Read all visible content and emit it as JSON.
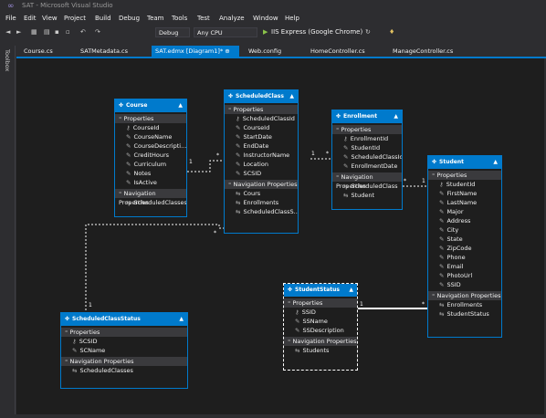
{
  "window": {
    "title": "SAT - Microsoft Visual Studio"
  },
  "menu": [
    "File",
    "Edit",
    "View",
    "Project",
    "Build",
    "Debug",
    "Team",
    "Tools",
    "Test",
    "Analyze",
    "Window",
    "Help"
  ],
  "toolbar": {
    "configuration": "Debug",
    "platform": "Any CPU",
    "run_label": "IIS Express (Google Chrome)"
  },
  "sidebar": {
    "toolbox_label": "Toolbox"
  },
  "tabs": [
    {
      "label": "Course.cs",
      "active": false
    },
    {
      "label": "SATMetadata.cs",
      "active": false
    },
    {
      "label": "SAT.edmx [Diagram1]*",
      "active": true
    },
    {
      "label": "Web.config",
      "active": false
    },
    {
      "label": "HomeController.cs",
      "active": false
    },
    {
      "label": "ManageController.cs",
      "active": false
    }
  ],
  "diagram": {
    "properties_label": "Properties",
    "nav_label": "Navigation Properties",
    "entities": {
      "course": {
        "name": "Course",
        "properties": [
          "CourseId",
          "CourseName",
          "CourseDescripti...",
          "CreditHours",
          "Curriculum",
          "Notes",
          "IsActive"
        ],
        "navigation": [
          "ScheduledClasses"
        ]
      },
      "scheduledclass": {
        "name": "ScheduledClass",
        "properties": [
          "ScheduledClassId",
          "CourseId",
          "StartDate",
          "EndDate",
          "InstructorName",
          "Location",
          "SCSID"
        ],
        "navigation": [
          "Cours",
          "Enrollments",
          "ScheduledClassS..."
        ]
      },
      "enrollment": {
        "name": "Enrollment",
        "properties": [
          "EnrollmentId",
          "StudentId",
          "ScheduledClassId",
          "EnrollmentDate"
        ],
        "navigation": [
          "ScheduledClass",
          "Student"
        ]
      },
      "student": {
        "name": "Student",
        "properties": [
          "StudentId",
          "FirstName",
          "LastName",
          "Major",
          "Address",
          "City",
          "State",
          "ZipCode",
          "Phone",
          "Email",
          "PhotoUrl",
          "SSID"
        ],
        "navigation": [
          "Enrollments",
          "StudentStatus"
        ]
      },
      "scheduledclassstatus": {
        "name": "ScheduledClassStatus",
        "properties": [
          "SCSID",
          "SCName"
        ],
        "navigation": [
          "ScheduledClasses"
        ]
      },
      "studentstatus": {
        "name": "StudentStatus",
        "properties": [
          "SSID",
          "SSName",
          "SSDescription"
        ],
        "navigation": [
          "Students"
        ]
      }
    },
    "multiplicity": {
      "one": "1",
      "many": "*"
    }
  }
}
